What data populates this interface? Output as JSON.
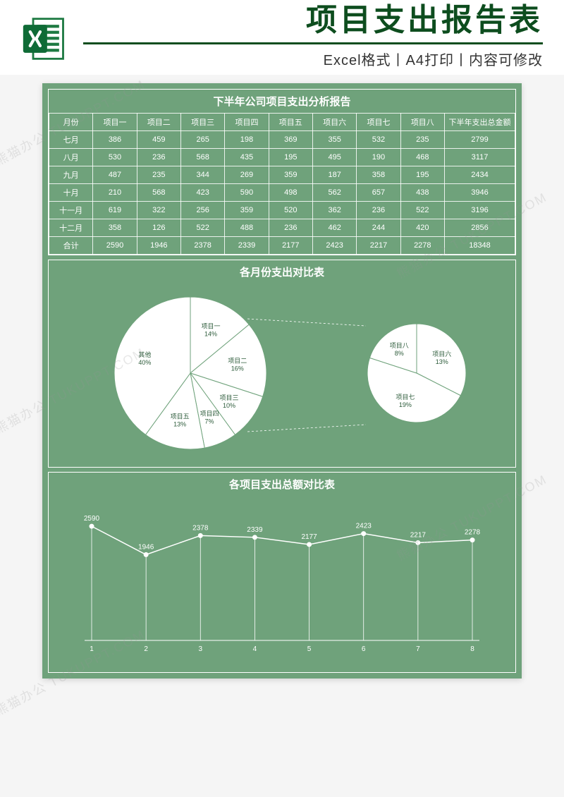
{
  "header": {
    "title_main": "项目支出报告表",
    "subtitle": "Excel格式丨A4打印丨内容可修改"
  },
  "table": {
    "title": "下半年公司项目支出分析报告",
    "headers": [
      "月份",
      "项目一",
      "项目二",
      "项目三",
      "项目四",
      "项目五",
      "项目六",
      "项目七",
      "项目八",
      "下半年支出总金额"
    ],
    "rows": [
      [
        "七月",
        "386",
        "459",
        "265",
        "198",
        "369",
        "355",
        "532",
        "235",
        "2799"
      ],
      [
        "八月",
        "530",
        "236",
        "568",
        "435",
        "195",
        "495",
        "190",
        "468",
        "3117"
      ],
      [
        "九月",
        "487",
        "235",
        "344",
        "269",
        "359",
        "187",
        "358",
        "195",
        "2434"
      ],
      [
        "十月",
        "210",
        "568",
        "423",
        "590",
        "498",
        "562",
        "657",
        "438",
        "3946"
      ],
      [
        "十一月",
        "619",
        "322",
        "256",
        "359",
        "520",
        "362",
        "236",
        "522",
        "3196"
      ],
      [
        "十二月",
        "358",
        "126",
        "522",
        "488",
        "236",
        "462",
        "244",
        "420",
        "2856"
      ],
      [
        "合计",
        "2590",
        "1946",
        "2378",
        "2339",
        "2177",
        "2423",
        "2217",
        "2278",
        "18348"
      ]
    ]
  },
  "chart_data": [
    {
      "type": "pie",
      "title": "各月份支出对比表",
      "series": [
        {
          "name": "main",
          "labels": [
            "项目一",
            "项目二",
            "项目三",
            "项目四",
            "项目五",
            "其他"
          ],
          "values": [
            14,
            16,
            10,
            7,
            13,
            40
          ]
        },
        {
          "name": "breakout",
          "labels": [
            "项目六",
            "项目七",
            "项目八"
          ],
          "values": [
            13,
            19,
            8
          ]
        }
      ]
    },
    {
      "type": "line",
      "title": "各项目支出总额对比表",
      "categories": [
        "1",
        "2",
        "3",
        "4",
        "5",
        "6",
        "7",
        "8"
      ],
      "values": [
        2590,
        1946,
        2378,
        2339,
        2177,
        2423,
        2217,
        2278
      ],
      "ylim": [
        0,
        2800
      ]
    }
  ],
  "watermark": "熊猫办公  TUKUPPT.COM"
}
